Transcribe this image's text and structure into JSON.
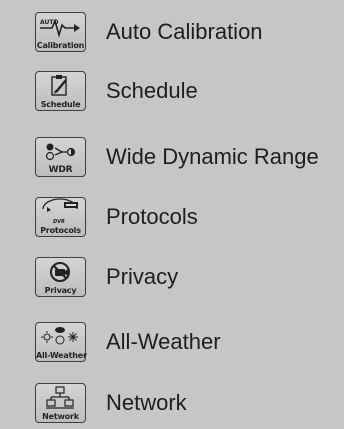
{
  "menu": {
    "items": [
      {
        "label": "Auto Calibration",
        "icon_caption": "Calibration",
        "icon_badge": "AUTO",
        "icon": "auto-calibration-icon"
      },
      {
        "label": "Schedule",
        "icon_caption": "Schedule",
        "icon": "schedule-icon"
      },
      {
        "label": "Wide Dynamic Range",
        "icon_caption": "WDR",
        "icon": "wdr-icon"
      },
      {
        "label": "Protocols",
        "icon_caption": "Protocols",
        "icon_badge": "DVR",
        "icon": "protocols-icon"
      },
      {
        "label": "Privacy",
        "icon_caption": "Privacy",
        "icon": "privacy-icon"
      },
      {
        "label": "All-Weather",
        "icon_caption": "All-Weather",
        "icon": "all-weather-icon"
      },
      {
        "label": "Network",
        "icon_caption": "Network",
        "icon": "network-icon"
      }
    ]
  },
  "colors": {
    "background": "#c6c6c6",
    "icon_border": "#3f3f3f",
    "text": "#1e1e1e"
  }
}
